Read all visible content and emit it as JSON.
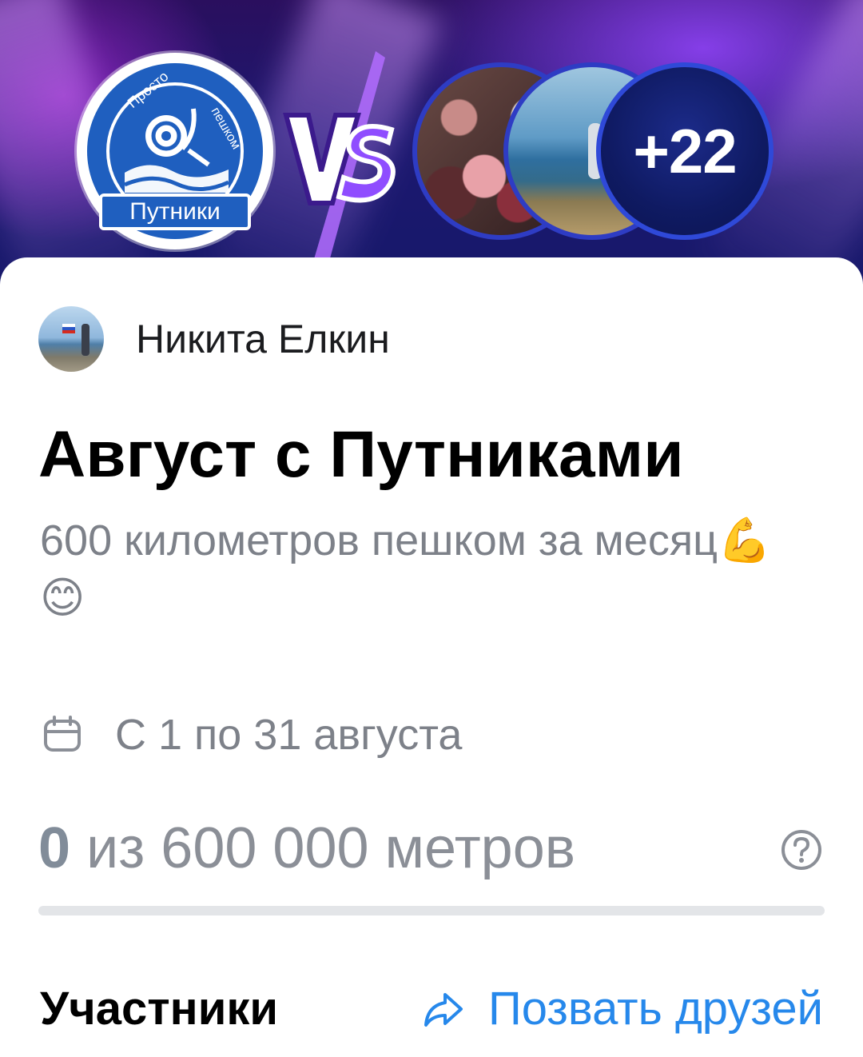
{
  "banner": {
    "team_name": "Путники",
    "team_arc_left": "Просто",
    "team_arc_right": "пешком",
    "vs_label": "VS",
    "extra_count": "+22"
  },
  "author": {
    "name": "Никита Елкин"
  },
  "challenge": {
    "title": "Август с Путниками",
    "description": "600 километров пешком за месяц💪😊",
    "dates": "С 1 по 31 августа",
    "progress": {
      "current": "0",
      "rest": " из 600 000 метров",
      "fraction": 0
    }
  },
  "footer": {
    "participants_label": "Участники",
    "invite_label": "Позвать друзей"
  },
  "colors": {
    "accent": "#2688eb",
    "secondary_text": "#7d8189",
    "banner_dark": "#16186a"
  },
  "icons": [
    "calendar-icon",
    "help-icon",
    "share-arrow-icon"
  ]
}
